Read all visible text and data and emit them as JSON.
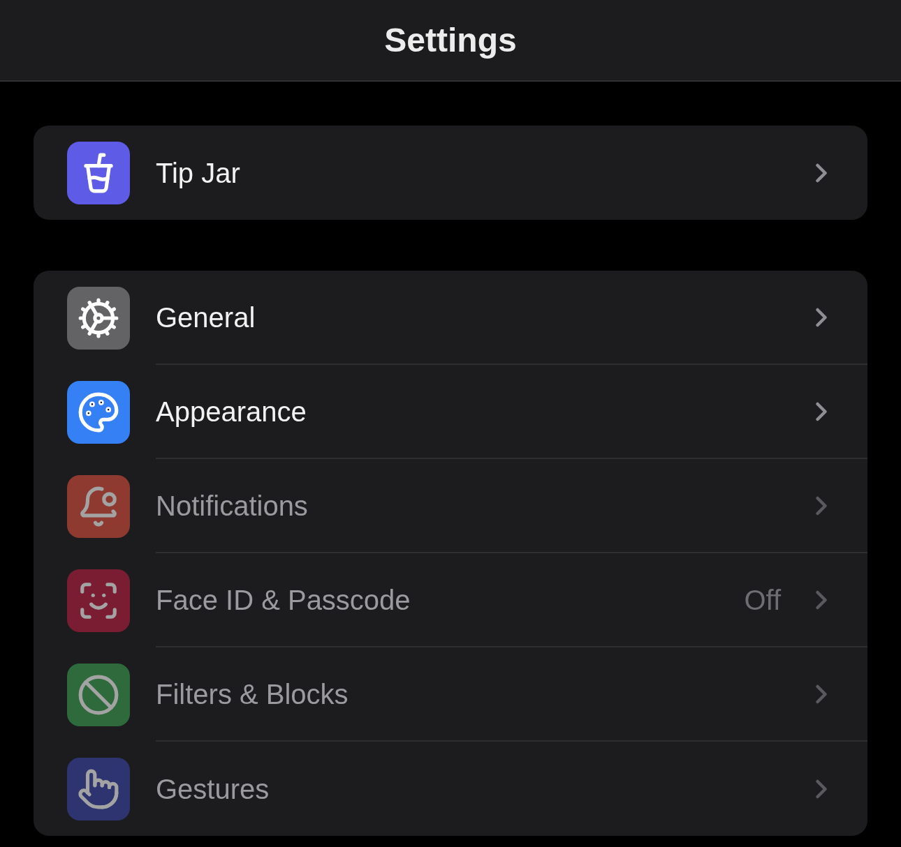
{
  "header": {
    "title": "Settings"
  },
  "sections": [
    {
      "rows": [
        {
          "kind": "cup",
          "color": "#5e5ce6",
          "label": "Tip Jar",
          "disabled": false
        }
      ]
    },
    {
      "rows": [
        {
          "kind": "gear",
          "color": "#636366",
          "label": "General",
          "disabled": false
        },
        {
          "kind": "palette",
          "color": "#3580f5",
          "label": "Appearance",
          "disabled": false
        },
        {
          "kind": "bell",
          "color": "#8f3a31",
          "label": "Notifications",
          "disabled": true
        },
        {
          "kind": "face",
          "color": "#7a1d33",
          "label": "Face ID & Passcode",
          "value": "Off",
          "disabled": true
        },
        {
          "kind": "ban",
          "color": "#2f6a3c",
          "label": "Filters & Blocks",
          "disabled": true
        },
        {
          "kind": "hand",
          "color": "#2d346f",
          "label": "Gestures",
          "disabled": true
        }
      ]
    }
  ]
}
